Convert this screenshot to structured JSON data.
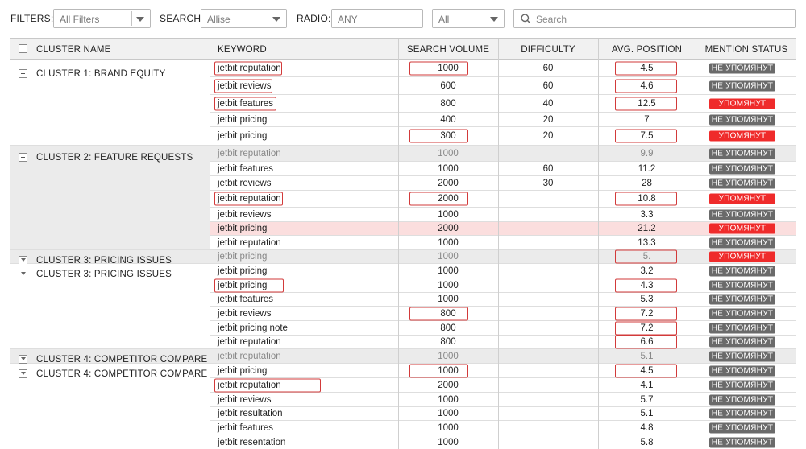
{
  "filters": {
    "filters_label": "FILTERS:",
    "filters_value": "All Filters",
    "search_label": "SEARCH:",
    "search_value": "Allise",
    "radio_label": "RADIO:",
    "radio_value": "ANY",
    "all_value": "All",
    "search_placeholder": "Search"
  },
  "columns": {
    "cluster": "CLUSTER NAME",
    "keyword": "KEYWORD",
    "volume": "SEARCH VOLUME",
    "difficulty": "DIFFICULTY",
    "position": "AVG. POSITION",
    "status": "MENTION STATUS"
  },
  "status_labels": {
    "no": "НЕ УПОМЯНУТ",
    "yes": "УПОМЯНУТ"
  },
  "clusters": [
    {
      "name": "CLUSTER 1: BRAND EQUITY",
      "toggle": "minus"
    },
    {
      "name": "CLUSTER 2: FEATURE REQUESTS",
      "toggle": "minus"
    },
    {
      "name": "CLUSTER 3: PRICING ISSUES",
      "toggle": "chevron"
    },
    {
      "name": "CLUSTER 3: PRICING ISSUES",
      "toggle": "chevron"
    },
    {
      "name": "CLUSTER 4: COMPETITOR COMPARE",
      "toggle": "chevron"
    },
    {
      "name": "CLUSTER 4: COMPETITOR COMPARE",
      "toggle": "chevron"
    }
  ],
  "rows": [
    {
      "keyword": "jetbit reputation",
      "volume": "1000",
      "difficulty": "60",
      "position": "4.5",
      "status": "no"
    },
    {
      "keyword": "jetbit reviews",
      "volume": "600",
      "difficulty": "60",
      "position": "4.6",
      "status": "no"
    },
    {
      "keyword": "jetbit features",
      "volume": "800",
      "difficulty": "40",
      "position": "12.5",
      "status": "yes"
    },
    {
      "keyword": "jetbit pricing",
      "volume": "400",
      "difficulty": "20",
      "position": "7",
      "status": "no"
    },
    {
      "keyword": "jetbit pricing",
      "volume": "300",
      "difficulty": "20",
      "position": "7.5",
      "status": "yes"
    },
    {
      "keyword": "jetbit reputation",
      "volume": "1000",
      "difficulty": "",
      "position": "9.9",
      "status": "no"
    },
    {
      "keyword": "jetbit features",
      "volume": "1000",
      "difficulty": "60",
      "position": "11.2",
      "status": "no"
    },
    {
      "keyword": "jetbit reviews",
      "volume": "2000",
      "difficulty": "30",
      "position": "28",
      "status": "no"
    },
    {
      "keyword": "jetbit reputation",
      "volume": "2000",
      "difficulty": "",
      "position": "10.8",
      "status": "yes"
    },
    {
      "keyword": "jetbit reviews",
      "volume": "1000",
      "difficulty": "",
      "position": "3.3",
      "status": "no"
    },
    {
      "keyword": "jetbit pricing",
      "volume": "2000",
      "difficulty": "",
      "position": "21.2",
      "status": "yes"
    },
    {
      "keyword": "jetbit reputation",
      "volume": "1000",
      "difficulty": "",
      "position": "13.3",
      "status": "no"
    },
    {
      "keyword": "jetbit pricing",
      "volume": "1000",
      "difficulty": "",
      "position": "5.",
      "status": "yes"
    },
    {
      "keyword": "jetbit pricing",
      "volume": "1000",
      "difficulty": "",
      "position": "3.2",
      "status": "no"
    },
    {
      "keyword": "jetbit pricing",
      "volume": "1000",
      "difficulty": "",
      "position": "4.3",
      "status": "no"
    },
    {
      "keyword": "jetbit features",
      "volume": "1000",
      "difficulty": "",
      "position": "5.3",
      "status": "no"
    },
    {
      "keyword": "jetbit reviews",
      "volume": "800",
      "difficulty": "",
      "position": "7.2",
      "status": "no"
    },
    {
      "keyword": "jetbit pricing note",
      "volume": "800",
      "difficulty": "",
      "position": "7.2",
      "status": "no"
    },
    {
      "keyword": "jetbit reputation",
      "volume": "800",
      "difficulty": "",
      "position": "6.6",
      "status": "no"
    },
    {
      "keyword": "jetbit reputation",
      "volume": "1000",
      "difficulty": "",
      "position": "5.1",
      "status": "no"
    },
    {
      "keyword": "jetbit pricing",
      "volume": "1000",
      "difficulty": "",
      "position": "4.5",
      "status": "no"
    },
    {
      "keyword": "jetbit reputation",
      "volume": "2000",
      "difficulty": "",
      "position": "4.1",
      "status": "no"
    },
    {
      "keyword": "jetbit reviews",
      "volume": "1000",
      "difficulty": "",
      "position": "5.7",
      "status": "no"
    },
    {
      "keyword": "jetbit resultation",
      "volume": "1000",
      "difficulty": "",
      "position": "5.1",
      "status": "no"
    },
    {
      "keyword": "jetbit features",
      "volume": "1000",
      "difficulty": "",
      "position": "4.8",
      "status": "no"
    },
    {
      "keyword": "jetbit resentation",
      "volume": "1000",
      "difficulty": "",
      "position": "5.8",
      "status": "no"
    }
  ]
}
